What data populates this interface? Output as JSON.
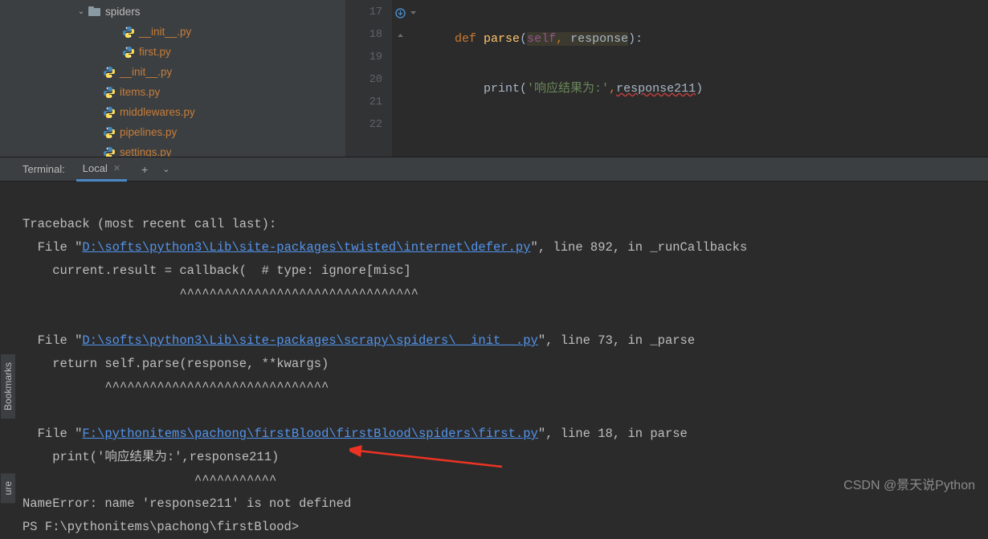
{
  "sidebar": {
    "items": [
      {
        "indent": 96,
        "chevron": "⌄",
        "type": "folder",
        "label": "spiders"
      },
      {
        "indent": 152,
        "chevron": "",
        "type": "py",
        "label": "__init__.py"
      },
      {
        "indent": 152,
        "chevron": "",
        "type": "py",
        "label": "first.py"
      },
      {
        "indent": 128,
        "chevron": "",
        "type": "py",
        "label": "__init__.py"
      },
      {
        "indent": 128,
        "chevron": "",
        "type": "py",
        "label": "items.py"
      },
      {
        "indent": 128,
        "chevron": "",
        "type": "py",
        "label": "middlewares.py"
      },
      {
        "indent": 128,
        "chevron": "",
        "type": "py",
        "label": "pipelines.py"
      },
      {
        "indent": 128,
        "chevron": "",
        "type": "py",
        "label": "settings.py"
      }
    ]
  },
  "editor": {
    "line_numbers": [
      "17",
      "18",
      "19",
      "20",
      "21",
      "22"
    ],
    "code": {
      "def": "def",
      "fn": "parse",
      "self": "self",
      "param": "response",
      "fn2": "print",
      "str": "'响应结果为:'",
      "var": "response211"
    }
  },
  "terminal": {
    "title": "Terminal:",
    "tab": "Local",
    "lines": {
      "l1": "Traceback (most recent call last):",
      "l2a": "  File \"",
      "l2link": "D:\\softs\\python3\\Lib\\site-packages\\twisted\\internet\\defer.py",
      "l2b": "\", line 892, in _runCallbacks",
      "l3": "    current.result = callback(  # type: ignore[misc]",
      "l4": "                     ^^^^^^^^^^^^^^^^^^^^^^^^^^^^^^^^",
      "l5": "",
      "l6a": "  File \"",
      "l6link": "D:\\softs\\python3\\Lib\\site-packages\\scrapy\\spiders\\__init__.py",
      "l6b": "\", line 73, in _parse",
      "l7": "    return self.parse(response, **kwargs)",
      "l8": "           ^^^^^^^^^^^^^^^^^^^^^^^^^^^^^^",
      "l9": "",
      "l10a": "  File \"",
      "l10link": "F:\\pythonitems\\pachong\\firstBlood\\firstBlood\\spiders\\first.py",
      "l10b": "\", line 18, in parse",
      "l11": "    print('响应结果为:',response211)",
      "l12": "                       ^^^^^^^^^^^",
      "l13": "NameError: name 'response211' is not defined",
      "l14": "PS F:\\pythonitems\\pachong\\firstBlood>"
    }
  },
  "side_tabs": {
    "bookmarks": "Bookmarks",
    "structure": "ure"
  },
  "watermark": "CSDN @景天说Python"
}
